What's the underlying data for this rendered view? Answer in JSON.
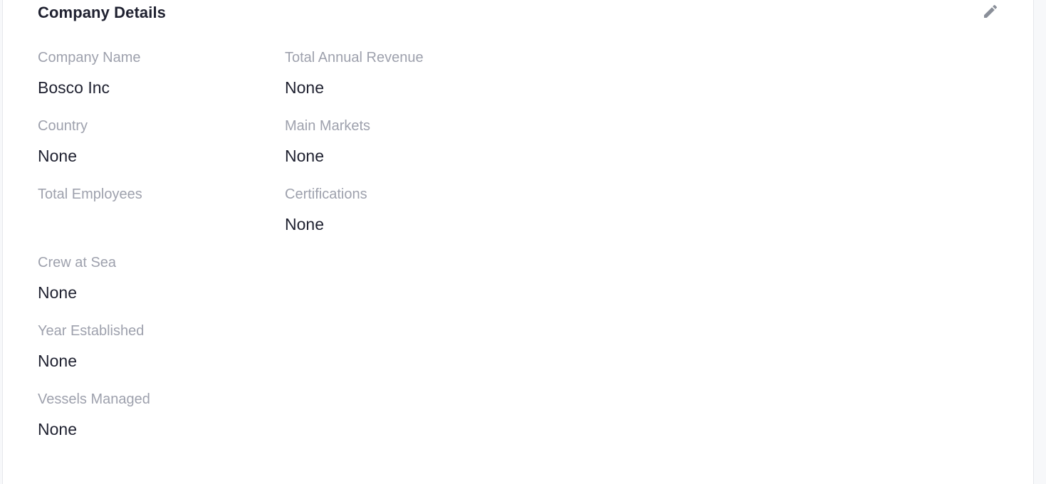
{
  "card": {
    "title": "Company Details",
    "edit_icon": "pencil-icon",
    "colors": {
      "title": "#1f2130",
      "label": "#9ea1ad",
      "value": "#1f2130",
      "icon": "#8a8f99"
    }
  },
  "fields_left": [
    {
      "label": "Company Name",
      "value": "Bosco Inc"
    },
    {
      "label": "Country",
      "value": "None"
    },
    {
      "label": "Total Employees",
      "value": ""
    },
    {
      "label": "Crew at Sea",
      "value": "None"
    },
    {
      "label": "Year Established",
      "value": "None"
    },
    {
      "label": "Vessels Managed",
      "value": "None"
    }
  ],
  "fields_right": [
    {
      "label": "Total Annual Revenue",
      "value": "None"
    },
    {
      "label": "Main Markets",
      "value": "None"
    },
    {
      "label": "Certifications",
      "value": "None"
    }
  ]
}
